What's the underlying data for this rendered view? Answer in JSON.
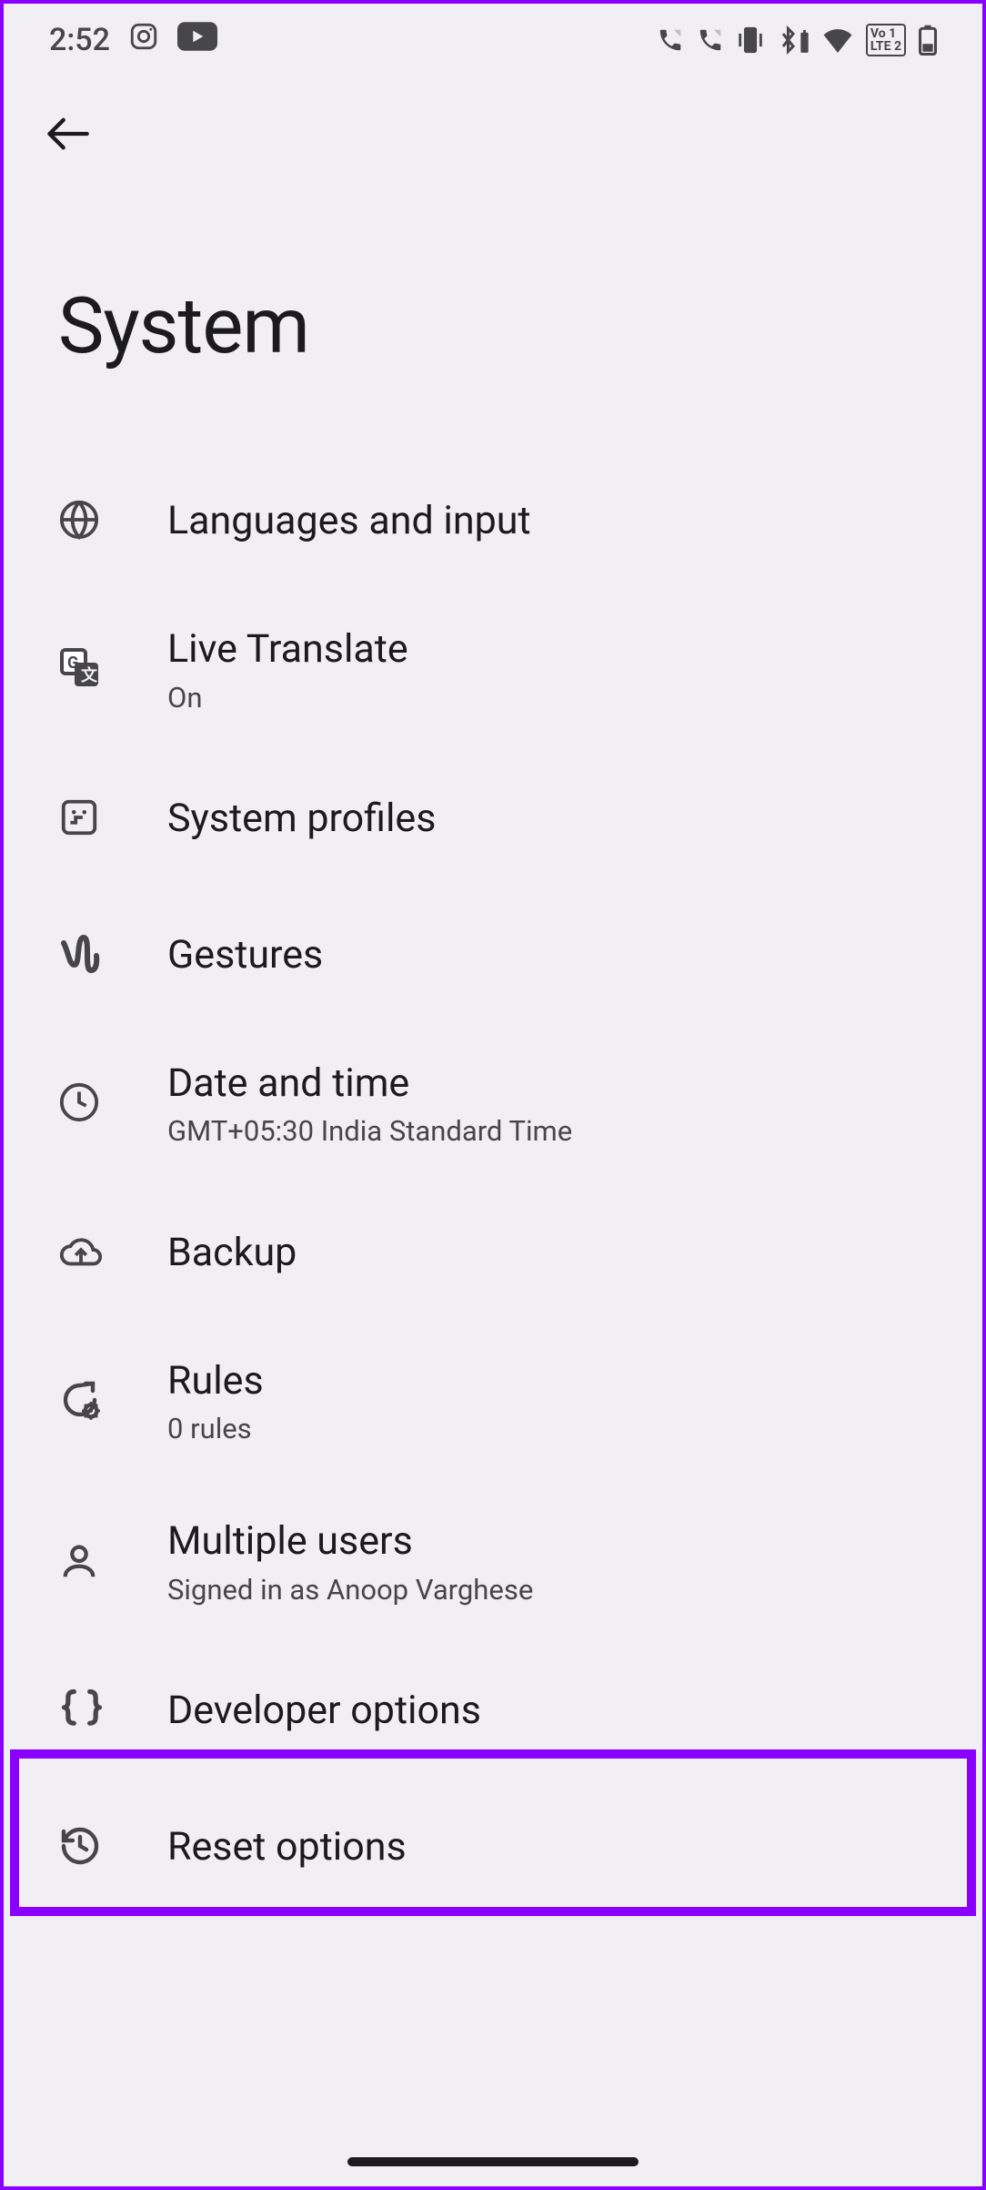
{
  "status": {
    "time": "2:52",
    "volte": "Vo 1\nLTE 2"
  },
  "header": {
    "title": "System"
  },
  "items": [
    {
      "label": "Languages and input",
      "sub": ""
    },
    {
      "label": "Live Translate",
      "sub": "On"
    },
    {
      "label": "System profiles",
      "sub": ""
    },
    {
      "label": "Gestures",
      "sub": ""
    },
    {
      "label": "Date and time",
      "sub": "GMT+05:30 India Standard Time"
    },
    {
      "label": "Backup",
      "sub": ""
    },
    {
      "label": "Rules",
      "sub": "0 rules"
    },
    {
      "label": "Multiple users",
      "sub": "Signed in as Anoop Varghese"
    },
    {
      "label": "Developer options",
      "sub": ""
    },
    {
      "label": "Reset options",
      "sub": ""
    }
  ]
}
